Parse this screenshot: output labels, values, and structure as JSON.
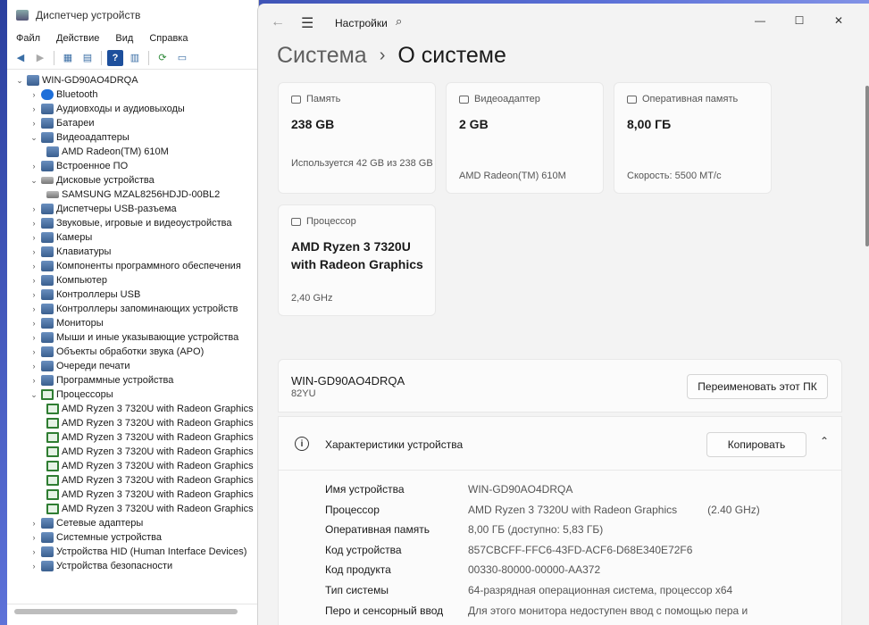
{
  "device_manager": {
    "title": "Диспетчер устройств",
    "menu": [
      "Файл",
      "Действие",
      "Вид",
      "Справка"
    ],
    "root": "WIN-GD90AO4DRQA",
    "tree": [
      {
        "label": "Bluetooth",
        "level": 1,
        "expanded": false,
        "icon": "bluetooth-icon"
      },
      {
        "label": "Аудиовходы и аудиовыходы",
        "level": 1,
        "expanded": false,
        "icon": "audio-icon"
      },
      {
        "label": "Батареи",
        "level": 1,
        "expanded": false,
        "icon": "battery-icon"
      },
      {
        "label": "Видеоадаптеры",
        "level": 1,
        "expanded": true,
        "icon": "display-adapter-icon"
      },
      {
        "label": "AMD Radeon(TM) 610M",
        "level": 2,
        "icon": "display-adapter-icon"
      },
      {
        "label": "Встроенное ПО",
        "level": 1,
        "expanded": false,
        "icon": "firmware-icon"
      },
      {
        "label": "Дисковые устройства",
        "level": 1,
        "expanded": true,
        "icon": "disk-icon"
      },
      {
        "label": "SAMSUNG MZAL8256HDJD-00BL2",
        "level": 2,
        "icon": "disk-icon"
      },
      {
        "label": "Диспетчеры USB-разъема",
        "level": 1,
        "expanded": false,
        "icon": "usb-icon"
      },
      {
        "label": "Звуковые, игровые и видеоустройства",
        "level": 1,
        "expanded": false,
        "icon": "sound-icon"
      },
      {
        "label": "Камеры",
        "level": 1,
        "expanded": false,
        "icon": "camera-icon"
      },
      {
        "label": "Клавиатуры",
        "level": 1,
        "expanded": false,
        "icon": "keyboard-icon"
      },
      {
        "label": "Компоненты программного обеспечения",
        "level": 1,
        "expanded": false,
        "icon": "software-icon"
      },
      {
        "label": "Компьютер",
        "level": 1,
        "expanded": false,
        "icon": "computer-icon"
      },
      {
        "label": "Контроллеры USB",
        "level": 1,
        "expanded": false,
        "icon": "usb-icon"
      },
      {
        "label": "Контроллеры запоминающих устройств",
        "level": 1,
        "expanded": false,
        "icon": "storage-icon"
      },
      {
        "label": "Мониторы",
        "level": 1,
        "expanded": false,
        "icon": "monitor-icon"
      },
      {
        "label": "Мыши и иные указывающие устройства",
        "level": 1,
        "expanded": false,
        "icon": "mouse-icon"
      },
      {
        "label": "Объекты обработки звука (APO)",
        "level": 1,
        "expanded": false,
        "icon": "sound-icon"
      },
      {
        "label": "Очереди печати",
        "level": 1,
        "expanded": false,
        "icon": "printer-icon"
      },
      {
        "label": "Программные устройства",
        "level": 1,
        "expanded": false,
        "icon": "software-icon"
      },
      {
        "label": "Процессоры",
        "level": 1,
        "expanded": true,
        "icon": "cpu-icon"
      },
      {
        "label": "AMD Ryzen 3 7320U with Radeon Graphics",
        "level": 2,
        "icon": "cpu-icon"
      },
      {
        "label": "AMD Ryzen 3 7320U with Radeon Graphics",
        "level": 2,
        "icon": "cpu-icon"
      },
      {
        "label": "AMD Ryzen 3 7320U with Radeon Graphics",
        "level": 2,
        "icon": "cpu-icon"
      },
      {
        "label": "AMD Ryzen 3 7320U with Radeon Graphics",
        "level": 2,
        "icon": "cpu-icon"
      },
      {
        "label": "AMD Ryzen 3 7320U with Radeon Graphics",
        "level": 2,
        "icon": "cpu-icon"
      },
      {
        "label": "AMD Ryzen 3 7320U with Radeon Graphics",
        "level": 2,
        "icon": "cpu-icon"
      },
      {
        "label": "AMD Ryzen 3 7320U with Radeon Graphics",
        "level": 2,
        "icon": "cpu-icon"
      },
      {
        "label": "AMD Ryzen 3 7320U with Radeon Graphics",
        "level": 2,
        "icon": "cpu-icon"
      },
      {
        "label": "Сетевые адаптеры",
        "level": 1,
        "expanded": false,
        "icon": "network-icon"
      },
      {
        "label": "Системные устройства",
        "level": 1,
        "expanded": false,
        "icon": "system-icon"
      },
      {
        "label": "Устройства HID (Human Interface Devices)",
        "level": 1,
        "expanded": false,
        "icon": "hid-icon"
      },
      {
        "label": "Устройства безопасности",
        "level": 1,
        "expanded": false,
        "icon": "security-icon"
      }
    ]
  },
  "settings": {
    "app_title": "Настройки",
    "breadcrumb": {
      "parent": "Система",
      "current": "О системе"
    },
    "cards": {
      "storage": {
        "label": "Память",
        "value": "238 GB",
        "sub": "Используется 42 GB из 238 GB"
      },
      "gpu": {
        "label": "Видеоадаптер",
        "value": "2 GB",
        "sub": "AMD Radeon(TM) 610M"
      },
      "ram": {
        "label": "Оперативная память",
        "value": "8,00 ГБ",
        "sub": "Скорость: 5500 МТ/с"
      },
      "cpu": {
        "label": "Процессор",
        "value_line1": "AMD Ryzen 3 7320U",
        "value_line2": "with Radeon Graphics",
        "sub": "2,40 GHz"
      }
    },
    "pc": {
      "name": "WIN-GD90AO4DRQA",
      "model": "82YU",
      "rename_label": "Переименовать этот ПК"
    },
    "specs": {
      "title": "Характеристики устройства",
      "copy_label": "Копировать",
      "rows": [
        {
          "k": "Имя устройства",
          "v": "WIN-GD90AO4DRQA",
          "v2": ""
        },
        {
          "k": "Процессор",
          "v": "AMD Ryzen 3 7320U with Radeon Graphics",
          "v2": "(2.40 GHz)"
        },
        {
          "k": "Оперативная память",
          "v": "8,00 ГБ (доступно: 5,83 ГБ)",
          "v2": ""
        },
        {
          "k": "Код устройства",
          "v": "857CBCFF-FFC6-43FD-ACF6-D68E340E72F6",
          "v2": ""
        },
        {
          "k": "Код продукта",
          "v": "00330-80000-00000-AA372",
          "v2": ""
        },
        {
          "k": "Тип системы",
          "v": "64-разрядная операционная система, процессор x64",
          "v2": ""
        },
        {
          "k": "Перо и сенсорный ввод",
          "v": "Для этого монитора недоступен ввод с помощью пера и",
          "v2": ""
        }
      ]
    }
  }
}
